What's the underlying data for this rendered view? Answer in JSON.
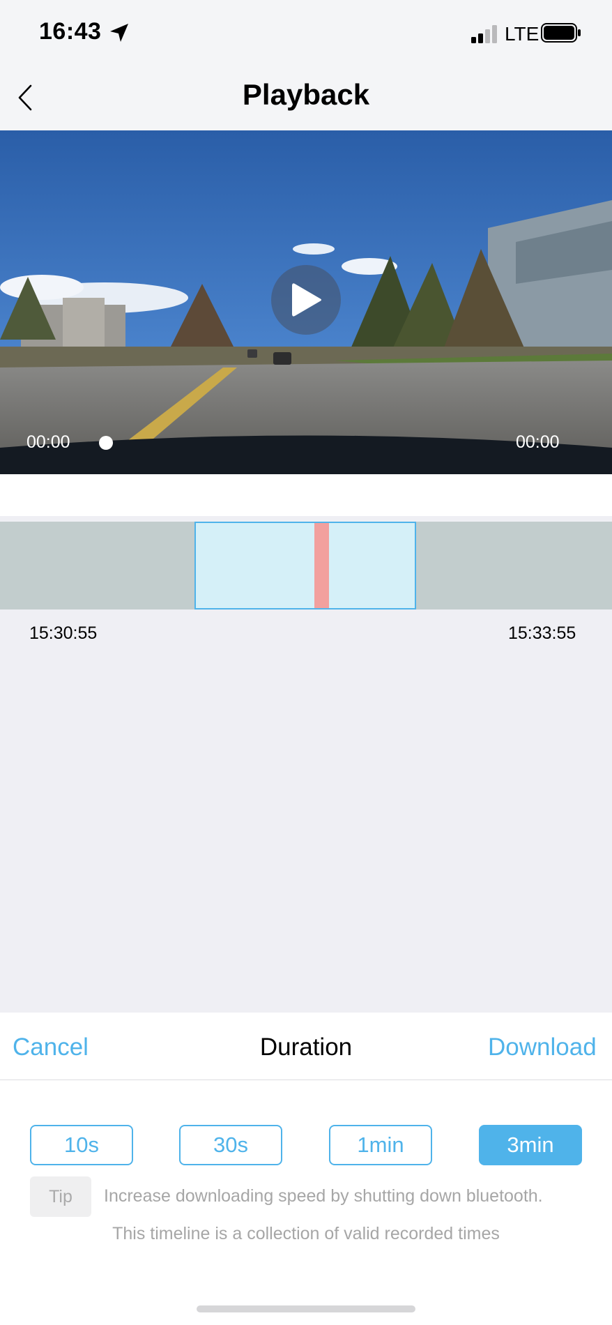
{
  "status_bar": {
    "time": "16:43",
    "network": "LTE",
    "icons": [
      "location-arrow-icon",
      "signal-icon",
      "battery-icon"
    ]
  },
  "nav": {
    "title": "Playback",
    "back_icon": "chevron-left-icon"
  },
  "video": {
    "current_time": "00:00",
    "total_time": "00:00",
    "play_icon": "play-icon"
  },
  "timeline": {
    "start_label": "15:30:55",
    "end_label": "15:33:55"
  },
  "sheet": {
    "cancel_label": "Cancel",
    "title": "Duration",
    "download_label": "Download",
    "durations": [
      {
        "label": "10s",
        "selected": false
      },
      {
        "label": "30s",
        "selected": false
      },
      {
        "label": "1min",
        "selected": false
      },
      {
        "label": "3min",
        "selected": true
      }
    ],
    "tip_badge": "Tip",
    "tip_text": "Increase downloading speed by shutting down bluetooth.",
    "note": "This timeline is a collection of valid recorded times"
  },
  "colors": {
    "accent": "#4fb3ea",
    "timeline_track": "#c2cdcd",
    "timeline_selection": "#d5f0f8",
    "timeline_cursor": "#f2a09e"
  }
}
